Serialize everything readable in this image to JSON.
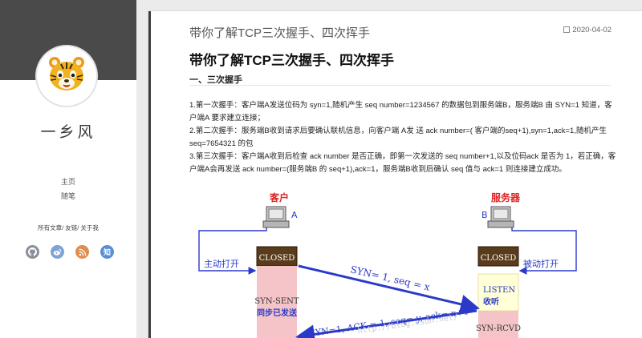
{
  "sidebar": {
    "site_name": "一乡风",
    "nav": [
      "主页",
      "随笔"
    ],
    "links": "所有文章/ 友链/ 关于我",
    "socials": [
      {
        "icon": "github-icon",
        "color": "#8a8f99"
      },
      {
        "icon": "weibo-icon",
        "color": "#7fa3d6"
      },
      {
        "icon": "rss-icon",
        "color": "#e08d4f"
      },
      {
        "icon": "zhihu-icon",
        "color": "#5a8fd6",
        "glyph": "知"
      }
    ]
  },
  "header": {
    "page_title": "带你了解TCP三次握手、四次挥手",
    "date": "2020-04-02"
  },
  "article": {
    "title": "带你了解TCP三次握手、四次挥手",
    "section": "一、三次握手",
    "p1": "1.第一次握手：客户端A发送位码为 syn=1,随机产生 seq number=1234567 的数据包到服务端B，服务端B 由 SYN=1 知道，客户端A 要求建立连接；",
    "p2": "2.第二次握手：服务端B收到请求后要确认联机信息，向客户端 A发 送 ack number=( 客户端的seq+1),syn=1,ack=1,随机产生 seq=7654321 的包",
    "p3": "3.第三次握手：客户端A收到后检查 ack number 是否正确，即第一次发送的 seq number+1,以及位码ack 是否为 1，若正确，客户端A会再发送 ack number=(服务端B 的 seq+1),ack=1，服务端B收到后确认 seq 值与 ack=1 则连接建立成功。"
  },
  "diagram": {
    "client_label": "客户",
    "server_label": "服务器",
    "client_letter": "A",
    "server_letter": "B",
    "closed": "CLOSED",
    "active_open": "主动打开",
    "passive_open": "被动打开",
    "msg1": "SYN= 1, seq = x",
    "msg2": "SYN=1, ACK = 1, seq= y, ack= x+1",
    "syn_sent": "SYN-SENT",
    "syn_sent_cn": "同步已发送",
    "listen": "LISTEN",
    "listen_cn": "收听",
    "syn_rcvd": "SYN-RCVD",
    "watermark": "http://blog.csdn.net/"
  }
}
